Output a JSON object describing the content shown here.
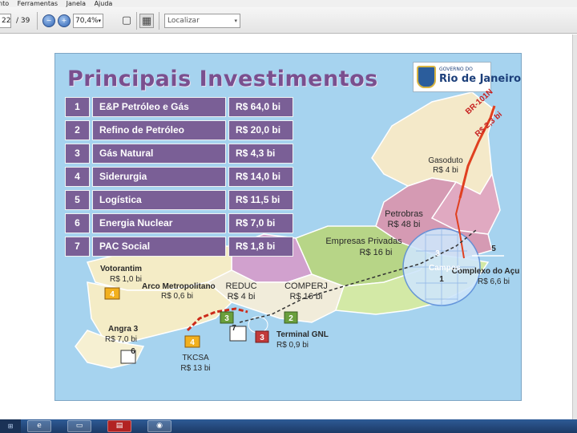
{
  "menu": {
    "items": [
      "nto",
      "Ferramentas",
      "Janela",
      "Ajuda"
    ]
  },
  "toolbar": {
    "page_current": "22",
    "page_total": "/ 39",
    "zoom_value": "70,4%",
    "zoom_arrow": "▾",
    "search_placeholder": "Localizar",
    "search_arrow": "▾",
    "icons": [
      "zoom-out-icon",
      "zoom-in-icon",
      "fit-page-icon",
      "two-page-icon"
    ]
  },
  "slide": {
    "title": "Principais Investimentos",
    "gov_logo": {
      "line1": "GOVERNO DO",
      "line2": "Rio de Janeiro"
    },
    "investments": [
      {
        "num": "1",
        "name": "E&P Petróleo e Gás",
        "value": "R$ 64,0 bi"
      },
      {
        "num": "2",
        "name": "Refino de Petróleo",
        "value": "R$ 20,0 bi"
      },
      {
        "num": "3",
        "name": "Gás Natural",
        "value": "R$ 4,3 bi"
      },
      {
        "num": "4",
        "name": "Siderurgia",
        "value": "R$ 14,0 bi"
      },
      {
        "num": "5",
        "name": "Logística",
        "value": "R$ 11,5 bi"
      },
      {
        "num": "6",
        "name": "Energia Nuclear",
        "value": "R$ 7,0 bi"
      },
      {
        "num": "7",
        "name": "PAC Social",
        "value": "R$ 1,8 bi"
      }
    ],
    "map_labels": {
      "br101_road": "BR-101N",
      "br101_value": "R$ 2,3 bi",
      "gasoduto_name": "Gasoduto",
      "gasoduto_value": "R$ 4 bi",
      "petrobras_name": "Petrobras",
      "petrobras_value": "R$ 48 bi",
      "privadas_name": "Empresas Privadas",
      "privadas_value": "R$ 16 bi",
      "votorantim_name": "Votorantim",
      "votorantim_value": "R$ 1,0 bi",
      "arco_name": "Arco Metropolitano",
      "arco_value": "R$ 0,6 bi",
      "reduc_name": "REDUC",
      "reduc_value": "R$ 4 bi",
      "comperj_name": "COMPERJ",
      "comperj_value": "R$ 16 bi",
      "acu_name": "Complexo do Açu",
      "acu_value": "R$ 6,6 bi",
      "campos_name": "Campos",
      "angra_name": "Angra 3",
      "angra_value": "R$ 7,0 bi",
      "tksa_name": "TKCSA",
      "tksa_value": "R$ 13 bi",
      "gnl_name": "Terminal GNL",
      "gnl_value": "R$ 0,9 bi",
      "marker_1": "1",
      "marker_2": "2",
      "marker_3": "3",
      "marker_4": "4",
      "marker_5": "5",
      "marker_6": "6",
      "marker_7": "7"
    }
  },
  "taskbar": {
    "tray": ""
  },
  "colors": {
    "table_cell": "#7a5f96",
    "title": "#7a4f8e",
    "sea": "#a6d3ef",
    "road": "#e04020"
  }
}
